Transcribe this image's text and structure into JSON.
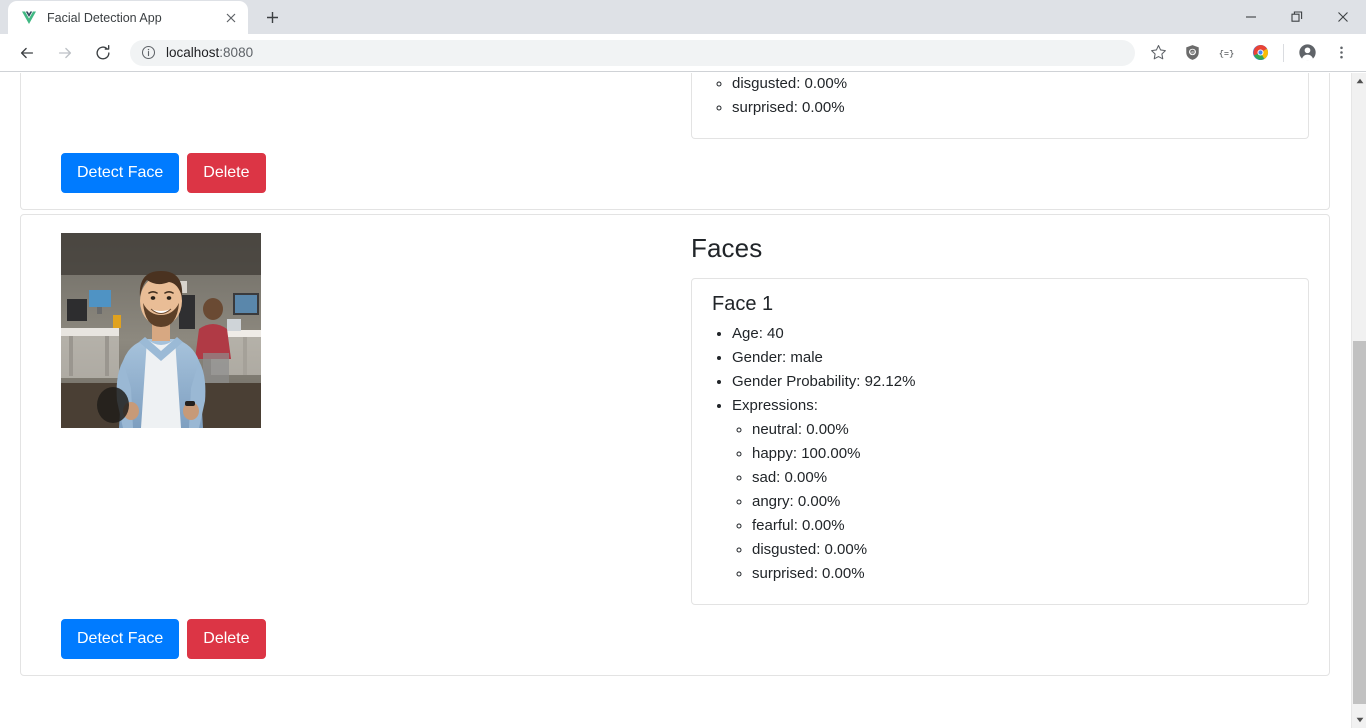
{
  "window": {
    "controls": [
      {
        "name": "minimize",
        "glyph": "–"
      },
      {
        "name": "restore",
        "glyph": "❐"
      },
      {
        "name": "close",
        "glyph": "✕"
      }
    ]
  },
  "tab": {
    "title": "Facial Detection App",
    "favicon": "vue-logo-icon",
    "close_glyph": "✕",
    "newtab_glyph": "+"
  },
  "toolbar": {
    "back_glyph": "←",
    "forward_glyph": "→",
    "reload_glyph": "↻",
    "address": {
      "host": "localhost",
      "port": ":8080",
      "info_icon": "info-circle-icon"
    },
    "bookmark_glyph": "☆",
    "extensions": [
      "ublock-origin-icon",
      "json-formatter-icon",
      "colorful-extension-icon"
    ],
    "profile_icon": "profile-avatar-icon",
    "menu_glyph": "⋮"
  },
  "scrollbar": {
    "up_glyph": "▲",
    "down_glyph": "▼"
  },
  "app": {
    "faces_heading": "Faces",
    "buttons": {
      "detect": "Detect Face",
      "delete": "Delete"
    },
    "cards": [
      {
        "id": "card-top-clipped",
        "clipped": true,
        "visible_expressions": [
          "disgusted: 0.00%",
          "surprised: 0.00%"
        ]
      },
      {
        "id": "card-second",
        "clipped": false,
        "faces_heading": "Faces",
        "face": {
          "title": "Face 1",
          "attributes": [
            "Age: 40",
            "Gender: male",
            "Gender Probability: 92.12%",
            "Expressions:"
          ],
          "expressions": [
            "neutral: 0.00%",
            "happy: 100.00%",
            "sad: 0.00%",
            "angry: 0.00%",
            "fearful: 0.00%",
            "disgusted: 0.00%",
            "surprised: 0.00%"
          ]
        }
      }
    ]
  },
  "colors": {
    "primary": "#007bff",
    "danger": "#dc3545",
    "card_border": "#e3e3e3",
    "text": "#212529",
    "chrome_bg": "#dee1e6"
  }
}
